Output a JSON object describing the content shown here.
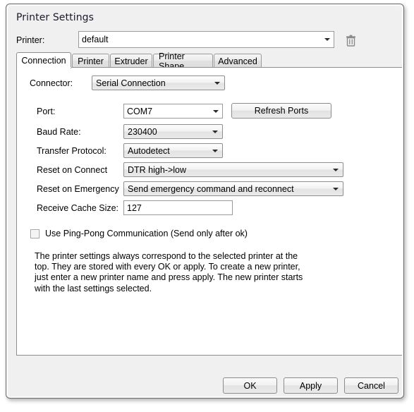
{
  "window": {
    "title": "Printer Settings"
  },
  "printer_row": {
    "label": "Printer:",
    "value": "default",
    "delete_icon": "trash-icon"
  },
  "tabs": [
    {
      "label": "Connection",
      "active": true
    },
    {
      "label": "Printer",
      "active": false
    },
    {
      "label": "Extruder",
      "active": false
    },
    {
      "label": "Printer Shape",
      "active": false
    },
    {
      "label": "Advanced",
      "active": false
    }
  ],
  "connection": {
    "connector_label": "Connector:",
    "connector_value": "Serial Connection",
    "port_label": "Port:",
    "port_value": "COM7",
    "refresh_ports_label": "Refresh Ports",
    "baud_label": "Baud Rate:",
    "baud_value": "230400",
    "protocol_label": "Transfer Protocol:",
    "protocol_value": "Autodetect",
    "reset_connect_label": "Reset on Connect",
    "reset_connect_value": "DTR high->low",
    "reset_emergency_label": "Reset on Emergency",
    "reset_emergency_value": "Send emergency command and reconnect",
    "cache_label": "Receive Cache Size:",
    "cache_value": "127",
    "pingpong_label": "Use Ping-Pong Communication (Send only after ok)",
    "pingpong_checked": false,
    "help_text": "The printer settings always correspond to the selected printer at the top. They are stored with every OK or apply. To create a new printer, just enter a new printer name and press apply. The new printer starts with the last settings selected."
  },
  "footer": {
    "ok_label": "OK",
    "apply_label": "Apply",
    "cancel_label": "Cancel"
  },
  "colors": {
    "dialog_bg": "#f0f0f0",
    "panel_bg": "#ffffff",
    "border": "#8d8d8d",
    "title_fg": "#1a1a2e"
  }
}
